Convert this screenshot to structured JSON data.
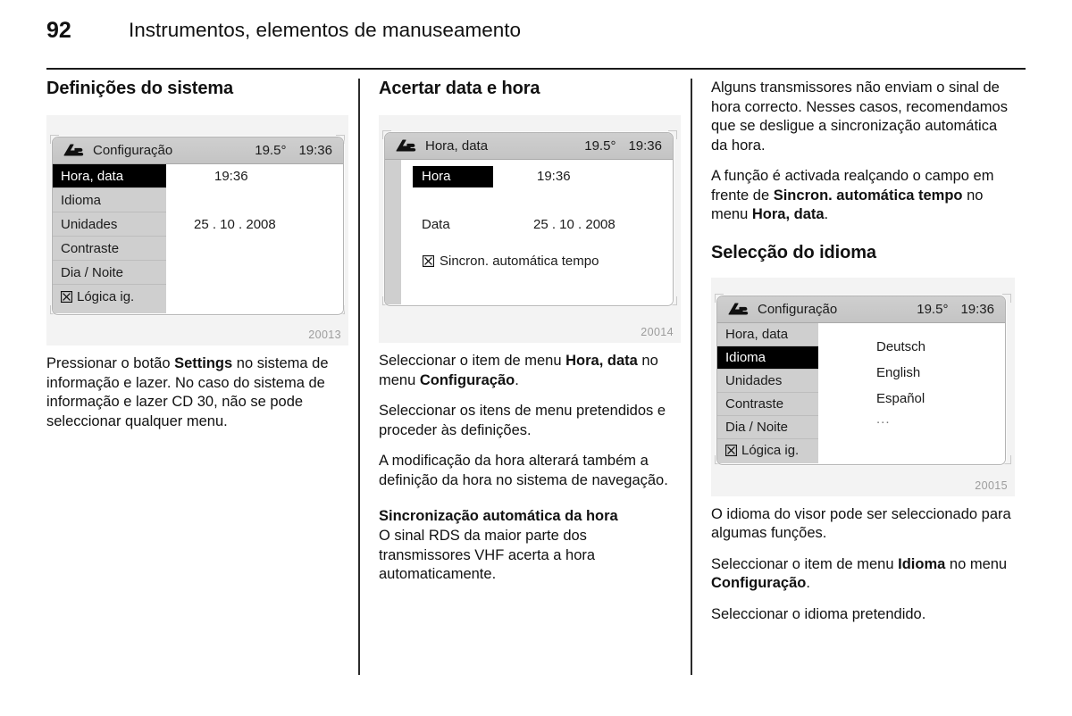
{
  "header": {
    "page_number": "92",
    "title": "Instrumentos, elementos de manuseamento"
  },
  "columns": {
    "col1": {
      "heading": "Definições do sistema",
      "figure_caption": "20013",
      "display": {
        "icon": "settings-wrench-icon",
        "title": "Configuração",
        "temperature": "19.5°",
        "clock": "19:36",
        "menu_items": [
          {
            "label": "Hora, data",
            "selected": true,
            "checkbox": false
          },
          {
            "label": "Idioma",
            "selected": false,
            "checkbox": false
          },
          {
            "label": "Unidades",
            "selected": false,
            "checkbox": false
          },
          {
            "label": "Contraste",
            "selected": false,
            "checkbox": false
          },
          {
            "label": "Dia / Noite",
            "selected": false,
            "checkbox": false
          },
          {
            "label": "Lógica ig.",
            "selected": false,
            "checkbox": true
          }
        ],
        "value_time": "19:36",
        "value_date": "25 . 10 . 2008"
      },
      "paragraphs": [
        {
          "runs": [
            {
              "t": "Pressionar o botão ",
              "b": false
            },
            {
              "t": "Settings",
              "b": true
            },
            {
              "t": " no sistema de informação e lazer. No caso do sistema de informação e lazer CD 30, não se pode seleccionar qualquer menu.",
              "b": false
            }
          ]
        }
      ]
    },
    "col2": {
      "heading": "Acertar data e hora",
      "figure_caption": "20014",
      "display": {
        "icon": "settings-wrench-icon",
        "title": "Hora, data",
        "temperature": "19.5°",
        "clock": "19:36",
        "row_time_label": "Hora",
        "row_time_value": "19:36",
        "row_date_label": "Data",
        "row_date_value": "25 . 10 . 2008",
        "row_sync_label": "Sincron. automática tempo",
        "row_sync_checked": true
      },
      "paragraphs": [
        {
          "runs": [
            {
              "t": "Seleccionar o item de menu ",
              "b": false
            },
            {
              "t": "Hora, data",
              "b": true
            },
            {
              "t": " no menu ",
              "b": false
            },
            {
              "t": "Configuração",
              "b": true
            },
            {
              "t": ".",
              "b": false
            }
          ]
        },
        {
          "runs": [
            {
              "t": "Seleccionar os itens de menu pretendidos e proceder às definições.",
              "b": false
            }
          ]
        },
        {
          "runs": [
            {
              "t": "A modificação da hora alterará também a definição da hora no sistema de navegação.",
              "b": false
            }
          ]
        }
      ],
      "subheading": "Sincronização automática da hora",
      "sub_paragraph": {
        "runs": [
          {
            "t": "O sinal RDS da maior parte dos transmissores VHF acerta a hora automaticamente.",
            "b": false
          }
        ]
      }
    },
    "col3": {
      "paragraphs_top": [
        {
          "runs": [
            {
              "t": "Alguns transmissores não enviam o sinal de hora correcto. Nesses casos, recomendamos que se desligue a sincronização automática da hora.",
              "b": false
            }
          ]
        },
        {
          "runs": [
            {
              "t": "A função é activada realçando o campo em frente de ",
              "b": false
            },
            {
              "t": "Sincron. automática tempo",
              "b": true
            },
            {
              "t": " no menu ",
              "b": false
            },
            {
              "t": "Hora, data",
              "b": true
            },
            {
              "t": ".",
              "b": false
            }
          ]
        }
      ],
      "heading": "Selecção do idioma",
      "figure_caption": "20015",
      "display": {
        "icon": "settings-wrench-icon",
        "title": "Configuração",
        "temperature": "19.5°",
        "clock": "19:36",
        "menu_items": [
          {
            "label": "Hora, data",
            "selected": false,
            "checkbox": false
          },
          {
            "label": "Idioma",
            "selected": true,
            "checkbox": false
          },
          {
            "label": "Unidades",
            "selected": false,
            "checkbox": false
          },
          {
            "label": "Contraste",
            "selected": false,
            "checkbox": false
          },
          {
            "label": "Dia / Noite",
            "selected": false,
            "checkbox": false
          },
          {
            "label": "Lógica ig.",
            "selected": false,
            "checkbox": true
          }
        ],
        "languages": [
          "Deutsch",
          "English",
          "Español",
          "..."
        ]
      },
      "paragraphs_bottom": [
        {
          "runs": [
            {
              "t": "O idioma do visor pode ser seleccionado para algumas funções.",
              "b": false
            }
          ]
        },
        {
          "runs": [
            {
              "t": "Seleccionar o item de menu ",
              "b": false
            },
            {
              "t": "Idioma",
              "b": true
            },
            {
              "t": " no menu ",
              "b": false
            },
            {
              "t": "Configuração",
              "b": true
            },
            {
              "t": ".",
              "b": false
            }
          ]
        },
        {
          "runs": [
            {
              "t": "Seleccionar o idioma pretendido.",
              "b": false
            }
          ]
        }
      ]
    }
  },
  "colors": {
    "text": "#111111",
    "display_header_bg": "#c8c8c8",
    "display_menu_bg": "#cfcfcf",
    "selected_bg": "#000000",
    "selected_fg": "#ffffff",
    "figure_bg": "#f3f3f3",
    "caption": "#9c9c9c"
  }
}
